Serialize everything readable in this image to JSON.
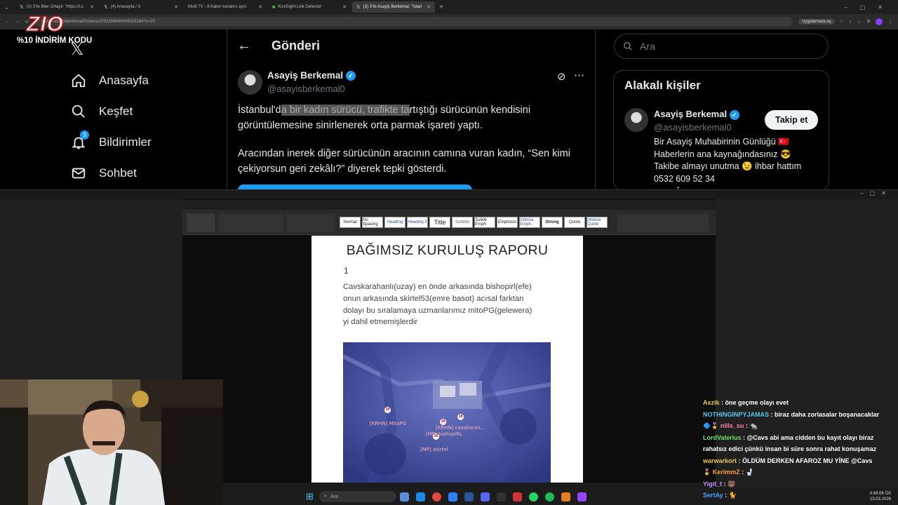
{
  "browser": {
    "tabs": [
      {
        "label": "(3) X'te İlber Ortaylı: \"https://t.c",
        "active": false
      },
      {
        "label": "(4) Anasayfa / X",
        "active": false
      },
      {
        "label": "Multi TV - 6 haber kanalını aynı",
        "active": false
      },
      {
        "label": "KickSight Link Detector",
        "active": false
      },
      {
        "label": "(3) X'te Asayiş Berkemal: \"İstan",
        "active": true
      }
    ],
    "url": "x.com/asayisberkemal0/status/2032388840049029284?s=20",
    "app_chip": "Uygulamada aç"
  },
  "overlay": {
    "brand": "ZIO",
    "promo": "%10 İNDİRİM KODU"
  },
  "x_nav": {
    "items": [
      {
        "label": "Anasayfa",
        "icon": "home-icon"
      },
      {
        "label": "Keşfet",
        "icon": "search-icon"
      },
      {
        "label": "Bildirimler",
        "icon": "bell-icon",
        "badge": "3"
      },
      {
        "label": "Sohbet",
        "icon": "mail-icon"
      }
    ]
  },
  "post": {
    "header": "Gönderi",
    "author_name": "Asayiş Berkemal",
    "author_handle": "@asayisberkemal0",
    "para1_pre": "İstanbul'd",
    "para1_hl": "a bir kadın sürücü, trafikte ta",
    "para1_post": "rtıştığı sürücünün kendisini görüntülemesine sinirlenerek orta parmak işareti yaptı.",
    "para2": "Aracından inerek diğer sürücünün aracının camına vuran kadın, “Sen kimi çekiyorsun geri zekâlı?” diyerek tepki gösterdi."
  },
  "search": {
    "placeholder": "Ara"
  },
  "related": {
    "title": "Alakalı kişiler",
    "name": "Asayiş Berkemal",
    "handle": "@asayisberkemal0",
    "follow": "Takip et",
    "bio_lines": [
      "Bir Asayiş Muhabirinin Günlüğü 🇹🇷",
      "Haberlerin ana kaynağındasınız 😎",
      "Takibe almayı unutma 😉 ihbar hattım",
      "0532 609 52 34"
    ]
  },
  "word": {
    "styles": [
      "Normal",
      "No Spacing",
      "Heading",
      "Heading 2",
      "Title",
      "Subtitle",
      "Subtle Emph.",
      "Emphasis",
      "Intense Emph.",
      "Strong",
      "Quote",
      "Intense Quote"
    ],
    "doc_title": "BAĞIMSIZ KURULUŞ RAPORU",
    "doc_number": "1",
    "doc_lines": [
      "Cavskarahanlı(uzay) en önde arkasında bishopirl(efe)",
      "onun arkasında skirtel53(emre basot) acısal farktan",
      "dolayı bu sıralamaya uzmanlarımız mitoPG(gelewera)",
      "yi dahil etmemişlerdir"
    ],
    "map_labels": [
      "[KRHN] MitoPG",
      "[KRHN] cavskarah...",
      "[MP] bishopIRL",
      "[MP] skirtel"
    ],
    "pin_text": "28"
  },
  "chat": [
    {
      "user": "Axzik",
      "color": "#e8c84a",
      "text": "öne geçme olayı evet"
    },
    {
      "user": "NOTHINGINPYJAMAS",
      "color": "#5ac7e8",
      "text": "biraz daha zorlasalar boşanacaklar"
    },
    {
      "user": "nills_su",
      "color": "#ff7fb0",
      "text": ""
    },
    {
      "user": "LordValerius",
      "color": "#6be06b",
      "text": "@Cavs abi ama cidden bu kayıt olayı biraz"
    },
    {
      "user": "",
      "color": "#ffffff",
      "text": "rahatsız edici çünkü insan bi süre sonra rahat konuşamaz"
    },
    {
      "user": "warwarkort",
      "color": "#e8c84a",
      "text": "ÖLDÜM DERKEN AFAROZ MU YİNE @Cavs"
    },
    {
      "user": "KerimmZ",
      "color": "#ff9a3c",
      "text": ""
    },
    {
      "user": "Yigit_t",
      "color": "#c58cff",
      "text": ""
    },
    {
      "user": "SertAy",
      "color": "#4aa3ff",
      "text": ""
    }
  ],
  "taskbar": {
    "search": "Ara",
    "time": "4:49:08 ÖS",
    "date": "13.03.2026"
  }
}
